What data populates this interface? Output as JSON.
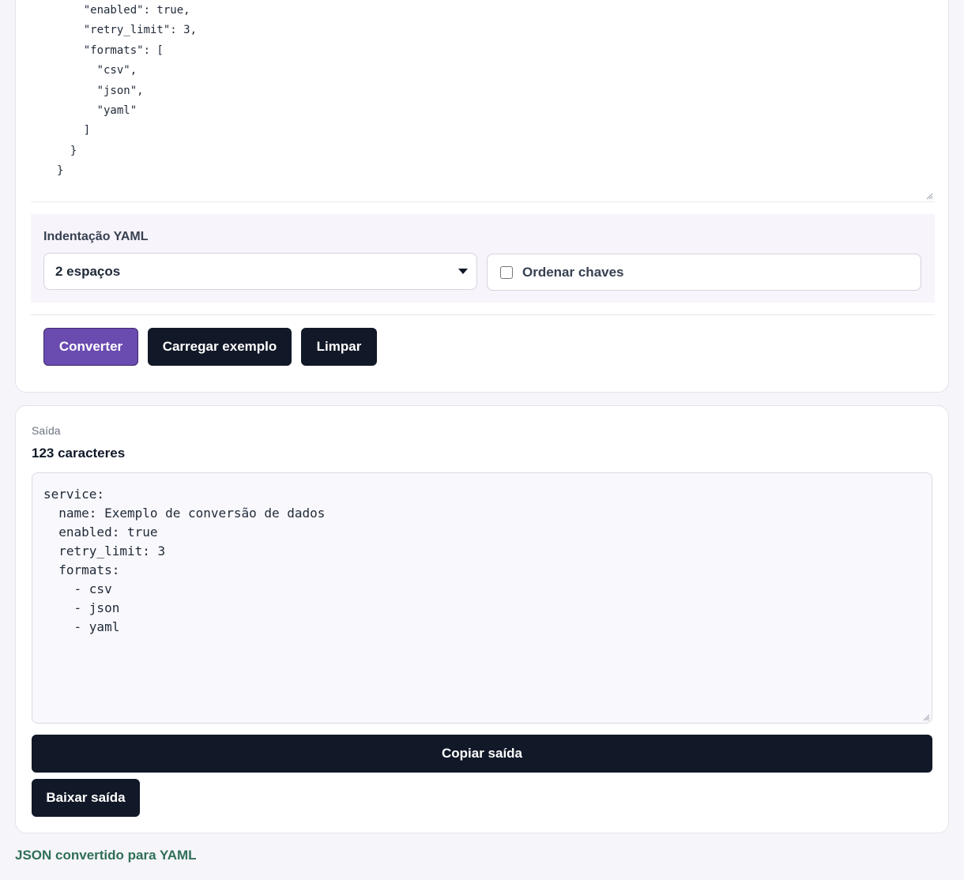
{
  "input": {
    "code": "    \"enabled\": true,\n    \"retry_limit\": 3,\n    \"formats\": [\n      \"csv\",\n      \"json\",\n      \"yaml\"\n    ]\n  }\n}"
  },
  "options": {
    "indent_label": "Indentação YAML",
    "indent_selected": "2 espaços",
    "sort_keys_label": "Ordenar chaves",
    "sort_keys_checked": false
  },
  "actions": {
    "convert_label": "Converter",
    "load_example_label": "Carregar exemplo",
    "clear_label": "Limpar"
  },
  "output": {
    "label": "Saída",
    "char_count": "123 caracteres",
    "code": "service:\n  name: Exemplo de conversão de dados\n  enabled: true\n  retry_limit: 3\n  formats:\n    - csv\n    - json\n    - yaml",
    "copy_label": "Copiar saída",
    "download_label": "Baixar saída"
  },
  "status": {
    "message": "JSON convertido para YAML",
    "color": "#2f6f58"
  },
  "colors": {
    "accent": "#6a4bb0",
    "dark_button": "#111827"
  }
}
